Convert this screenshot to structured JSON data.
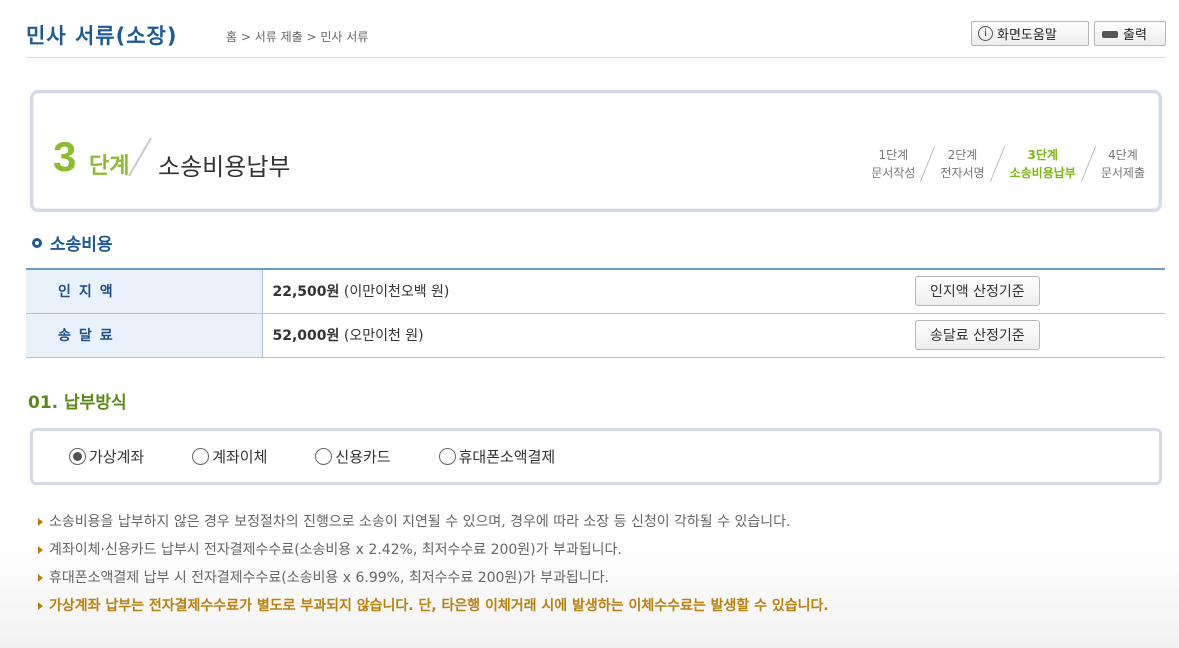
{
  "header": {
    "title": "민사 서류(소장)",
    "breadcrumb": "홈 > 서류 제출 > 민사 서류",
    "help_label": "화면도움말",
    "print_label": "출력"
  },
  "step": {
    "number": "3",
    "word": "단계",
    "title": "소송비용납부",
    "items": [
      {
        "num": "1단계",
        "label": "문서작성"
      },
      {
        "num": "2단계",
        "label": "전자서명"
      },
      {
        "num": "3단계",
        "label": "소송비용납부"
      },
      {
        "num": "4단계",
        "label": "문서제출"
      }
    ]
  },
  "cost": {
    "section_title": "소송비용",
    "rows": [
      {
        "label": "인지액",
        "amount": "22,500원",
        "amount_text": "(이만이천오백 원)",
        "button": "인지액 산정기준"
      },
      {
        "label": "송달료",
        "amount": "52,000원",
        "amount_text": "(오만이천 원)",
        "button": "송달료 산정기준"
      }
    ]
  },
  "payment": {
    "title": "01. 납부방식",
    "options": [
      "가상계좌",
      "계좌이체",
      "신용카드",
      "휴대폰소액결제"
    ],
    "selected": "가상계좌"
  },
  "notes": [
    "소송비용을 납부하지 않은 경우 보정절차의 진행으로 소송이 지연될 수 있으며, 경우에 따라 소장 등 신청이 각하될 수 있습니다.",
    "계좌이체·신용카드 납부시 전자결제수수료(소송비용 x 2.42%, 최저수수료 200원)가 부과됩니다.",
    "휴대폰소액결제 납부 시 전자결제수수료(소송비용 x 6.99%, 최저수수료 200원)가 부과됩니다.",
    "가상계좌 납부는 전자결제수수료가 별도로 부과되지 않습니다. 단, 타은행 이체거래 시에 발생하는 이체수수료는 발생할 수 있습니다."
  ],
  "colors": {
    "title_blue": "#1e5a96",
    "step_green": "#8dbc2f",
    "notice_orange": "#b8810f"
  }
}
